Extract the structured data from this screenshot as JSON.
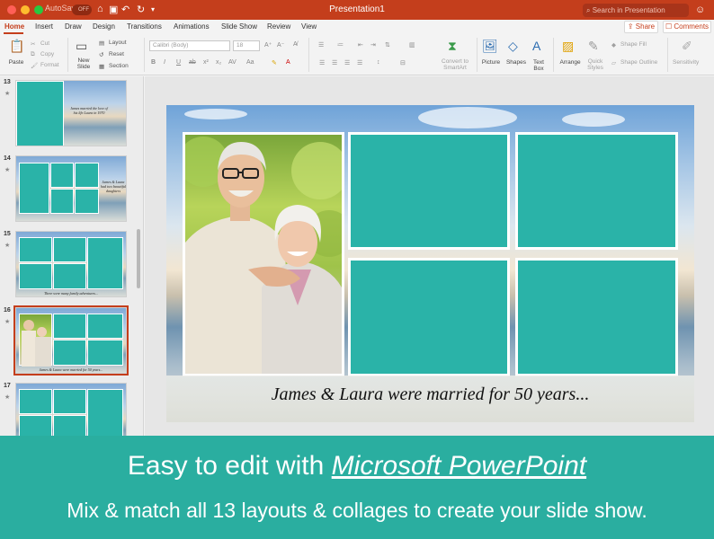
{
  "titlebar": {
    "autosave_label": "AutoSave",
    "autosave_state": "OFF",
    "doc_title": "Presentation1",
    "search_placeholder": "Search in Presentation"
  },
  "tabs": [
    "Home",
    "Insert",
    "Draw",
    "Design",
    "Transitions",
    "Animations",
    "Slide Show",
    "Review",
    "View"
  ],
  "share_label": "Share",
  "comments_label": "Comments",
  "ribbon": {
    "paste": "Paste",
    "cut": "Cut",
    "copy": "Copy",
    "format": "Format",
    "new_slide": "New Slide",
    "layout": "Layout",
    "reset": "Reset",
    "section": "Section",
    "font_name": "Calibri (Body)",
    "font_size": "18",
    "convert_smartart": "Convert to SmartArt",
    "picture": "Picture",
    "shapes": "Shapes",
    "text_box": "Text Box",
    "arrange": "Arrange",
    "quick_styles": "Quick Styles",
    "shape_fill": "Shape Fill",
    "shape_outline": "Shape Outline",
    "sensitivity": "Sensitivity"
  },
  "thumbnails": [
    {
      "number": "13",
      "caption": "James married the love of his life Laura in 1970"
    },
    {
      "number": "14",
      "caption": "James & Laura had two beautiful daughters"
    },
    {
      "number": "15",
      "caption": "There were many family adventures..."
    },
    {
      "number": "16",
      "caption": "James & Laura were married for 50 years..."
    },
    {
      "number": "17",
      "caption": ""
    }
  ],
  "slide": {
    "caption": "James & Laura were married for 50 years..."
  },
  "banner": {
    "line1_prefix": "Easy to edit with ",
    "line1_link": "Microsoft PowerPoint",
    "line2": "Mix & match all 13 layouts & collages to create your slide show."
  },
  "colors": {
    "title_bar": "#c43e1c",
    "teal": "#2ab3a8",
    "banner": "#2aaea0"
  }
}
